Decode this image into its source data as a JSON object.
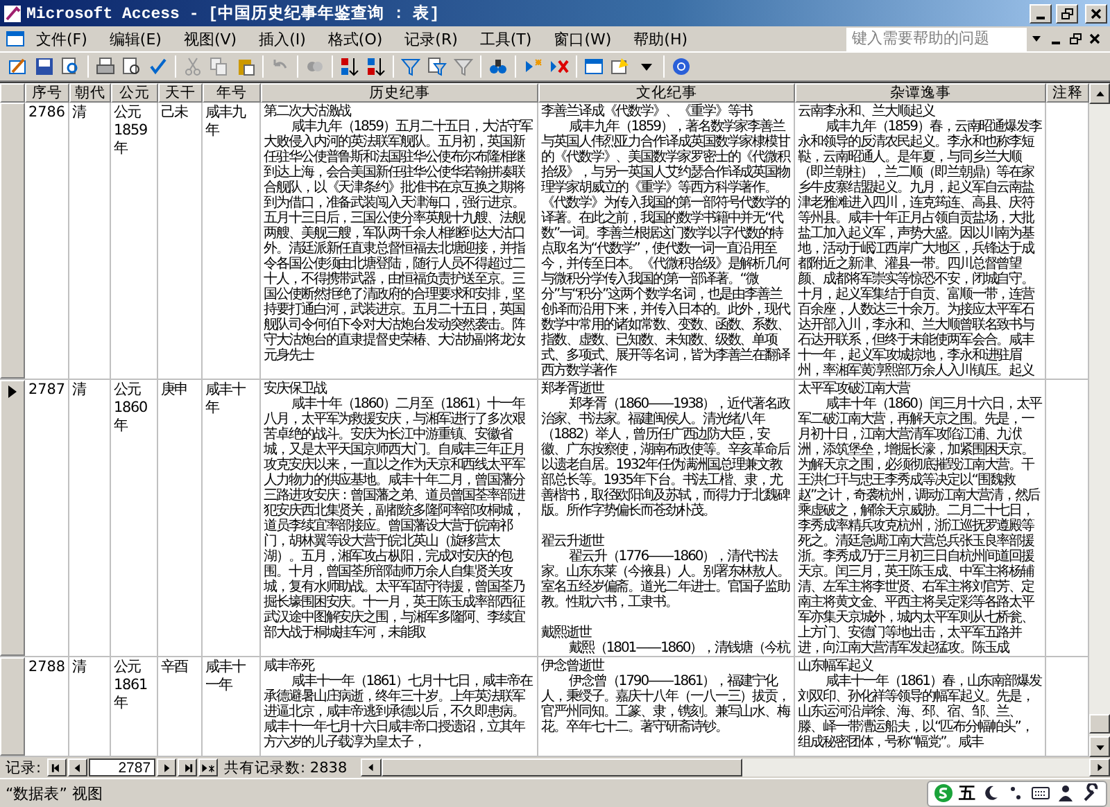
{
  "window": {
    "title": "Microsoft Access - [中国历史纪事年鉴查询 : 表]"
  },
  "menu": [
    "文件(F)",
    "编辑(E)",
    "视图(V)",
    "插入(I)",
    "格式(O)",
    "记录(R)",
    "工具(T)",
    "窗口(W)",
    "帮助(H)"
  ],
  "help_box": {
    "placeholder": "键入需要帮助的问题"
  },
  "table": {
    "columns": [
      "序号",
      "朝代",
      "公元",
      "天干",
      "年号",
      "历史纪事",
      "文化纪事",
      "杂谭逸事",
      "注释"
    ],
    "rows": [
      {
        "selected": false,
        "seq": "2786",
        "dynasty": "清",
        "year": "公元 1859年",
        "ganzhi": "己未",
        "era": "咸丰九年",
        "history": [
          {
            "title": "第二次大沽激战",
            "body": "咸丰九年（1859）五月二十五日，大沽守军大败侵入内河的英法联军舰队。五月初，英国新任驻华公使普鲁斯和法国驻华公使布尔布隆相继到达上海，会合美国新任驻华公使华若翰拼凑联合舰队，以《天津条约》批准书在京互换之期将到为借口，准备武装闯入天津海口，强行进京。五月十三日后，三国公使分率英舰十九艘、法舰两艘、美舰三艘，军队两千余人相继到达大沽口外。清廷派新任直隶总督恒福去北塘迎接，并指令各国公使须由北塘登陆，随行人员不得超过二十人，不得携带武器，由恒福负责护送至京。三国公使断然拒绝了清政府的合理要求和安排，坚持要打通白河，武装进京。五月二十五日，英国舰队司令何伯下令对大沽炮台发动突然袭击。阵守大沽炮台的直隶提督史荣椿、大沽协副将龙汝元身先士"
          }
        ],
        "culture": [
          {
            "title": "李善兰译成《代数学》、《重学》等书",
            "body": "咸丰九年（1859），著名数学家李善兰与英国人伟烈亚力合作译成英国数学家棣模甘的《代数学》、美国数学家罗密士的《代微积拾级》，与另一英国人艾约瑟合作译成英国物理学家胡威立的《重学》等西方科学著作。《代数学》为传入我国的第一部符号代数学的译著。在此之前，我国的数学书籍中并无“代数”一词。李善兰根据这门数学以字代数的特点取名为“代数学”，使代数一词一直沿用至今，并传至日本。《代微积拾级》是解析几何与微积分学传入我国的第一部译著。“微分”与“积分”这两个数学名词，也是由李善兰创译而沿用下来，并传入日本的。此外，现代数学中常用的诸如常数、变数、函数、系数、指数、虚数、已知数、未知数、级数、单项式、多项式、展开等名词，皆为李善兰在翻译西方数学著作"
          }
        ],
        "misc": [
          {
            "title": "云南李永和、兰大顺起义",
            "body": "咸丰九年（1859）春，云南昭通爆发李永和领导的反清农民起义。李永和也称李短鞑，云南昭通人。是年夏，与同乡兰大顺（即兰朝柱），兰二顺（即兰朝鼎）等在家乡牛皮寨结盟起义。九月，起义军自云南盐津老雅滩进入四川，连克筠连、高县、庆符等州县。咸丰十年正月占领自贡盐场，大批盐工加入起义军，声势大盛。因以川南为基地，活动于岷江西岸广大地区，兵锋达于成都附近之新津、灌县一带。四川总督曾望颜、成都将军崇实等惊恐不安，闭城自守。十月，起义军集结于自贡、富顺一带，连营百余座，人数达三十余万。为接应太平军石达开部入川，李永和、兰大顺曾联名致书与石达开联系，但终于未能使两军会合。咸丰十一年，起义军攻城掠地，李永和进驻眉州，率湘军黄淳熙部万余人入川镇压。起义"
          }
        ]
      },
      {
        "selected": true,
        "seq": "2787",
        "dynasty": "清",
        "year": "公元 1860年",
        "ganzhi": "庚申",
        "era": "咸丰十年",
        "history": [
          {
            "title": "安庆保卫战",
            "body": "咸丰十年（1860）二月至（1861）十一年八月，太平军为救援安庆，与湘军进行了多次艰苦卓绝的战斗。安庆为长江中游重镇、安徽省城，又是太平天国京师西大门。自咸丰三年正月攻克安庆以来，一直以之作为天京和西线太平军人力物力的供应基地。咸丰十年二月，曾国藩分三路进攻安庆：曾国藩之弟、道员曾国荃率部进犯安庆西北集贤关，副都统多隆阿率部攻桐城，道员李续宜率部接应。曾国藩设大营于皖南祁门，胡林翼等设大营于皖北英山（旋移营太湖）。五月，湘军攻占枞阳，完成对安庆的包围。十月，曾国荃所部陆师万余人自集贤关攻城，复有水师助战。太平军固守待援，曾国荃乃掘长壕围困安庆。十一月，英王陈玉成率部西征武汉途中图解安庆之围，与湘军多隆阿、李续宜部大战于桐城挂车河，未能取"
          }
        ],
        "culture": [
          {
            "title": "郑孝胥逝世",
            "body": "郑孝胥（1860——1938），近代著名政治家、书法家。福建闽侯人。清光绪八年（1882）举人，曾历任广西边防大臣，安徽、广东按察使，湖南布政使等。辛亥革命后以遗老自居。1932年任伪满洲国总理兼文教部总长等。1935年下台。书法工楷、隶，尤善楷书，取径欧阳询及苏轼，而得力于北魏碑版。所作字势偏长而苍劲朴茂。"
          },
          {
            "title": "翟云升逝世",
            "body": "翟云升（1776——1860），清代书法家。山东东莱（今掖县）人。别署东林敖人。室名五经岁偏斋。道光二年进士。官国子监助教。性耽六书，工隶书。"
          },
          {
            "title": "戴熙逝世",
            "body": "戴熙（1801——1860），清钱塘（今杭"
          }
        ],
        "misc": [
          {
            "title": "太平军攻破江南大营",
            "body": "咸丰十年（1860）闰三月十六日，太平军二破江南大营，再解天京之围。先是，一月初十日，江南大营清军攻陷江浦、九洑洲，添筑堡垒，增掘长濠，加紧围困天京。为解天京之围，必须彻底摧毁江南大营。干王洪仁玕与忠王李秀成等决定以“围魏救赵”之计，奇袭杭州，调动江南大营清，然后乘虚破之，解除天京威胁。二月二十七日，李秀成率精兵攻克杭州，浙江巡抚罗遵殿等死之。清廷急调江南大营总兵张玉良率部援浙。李秀成乃于三月初三日自杭州间道回援天京。闰三月，英王陈玉成、中军主将杨辅清、左军主将李世贤、右军主将刘官芳、定南主将黄文金、平西主将吴定彩等各路太平军亦集天京城外，城内太平军则从七桥瓮、上方门、安德门等地出击，太平军五路并进，向江南大营清军发起猛攻。陈玉成"
          }
        ]
      },
      {
        "selected": false,
        "seq": "2788",
        "dynasty": "清",
        "year": "公元 1861年",
        "ganzhi": "辛酉",
        "era": "咸丰十一年",
        "history": [
          {
            "title": "咸丰帝死",
            "body": "咸丰十一年（1861）七月十七日，咸丰帝在承德避暑山庄病逝，终年三十岁。上年英法联军进逼北京，咸丰帝逃到承德以后，不久即患病。咸丰十一年七月十六日咸丰帝口授遗诏，立其年方六岁的儿子载淳为皇太子，"
          }
        ],
        "culture": [
          {
            "title": "伊念曾逝世",
            "body": "伊念曾（1790——1861），福建宁化人，秉绶子。嘉庆十八年（一八一三）拔贡，官严州同知。工篆、隶，镌刻。兼写山水、梅花。卒年七十二。著守研斋诗钞。"
          }
        ],
        "misc": [
          {
            "title": "山东幅军起义",
            "body": "咸丰十一年（1861）春，山东南部爆发刘双印、孙化祥等领导的幅军起义。先是，山东运河沿岸徐、海、邳、宿、邹、兰、滕、峄一带漕运船夫，以“匹布分幅帕头”，组成秘密团体，号称“幅党”。咸丰"
          }
        ]
      }
    ]
  },
  "navigator": {
    "label": "记录:",
    "current": "2787",
    "total": "共有记录数: 2838"
  },
  "status_bar": {
    "view": "“数据表” 视图",
    "ime": "五"
  }
}
